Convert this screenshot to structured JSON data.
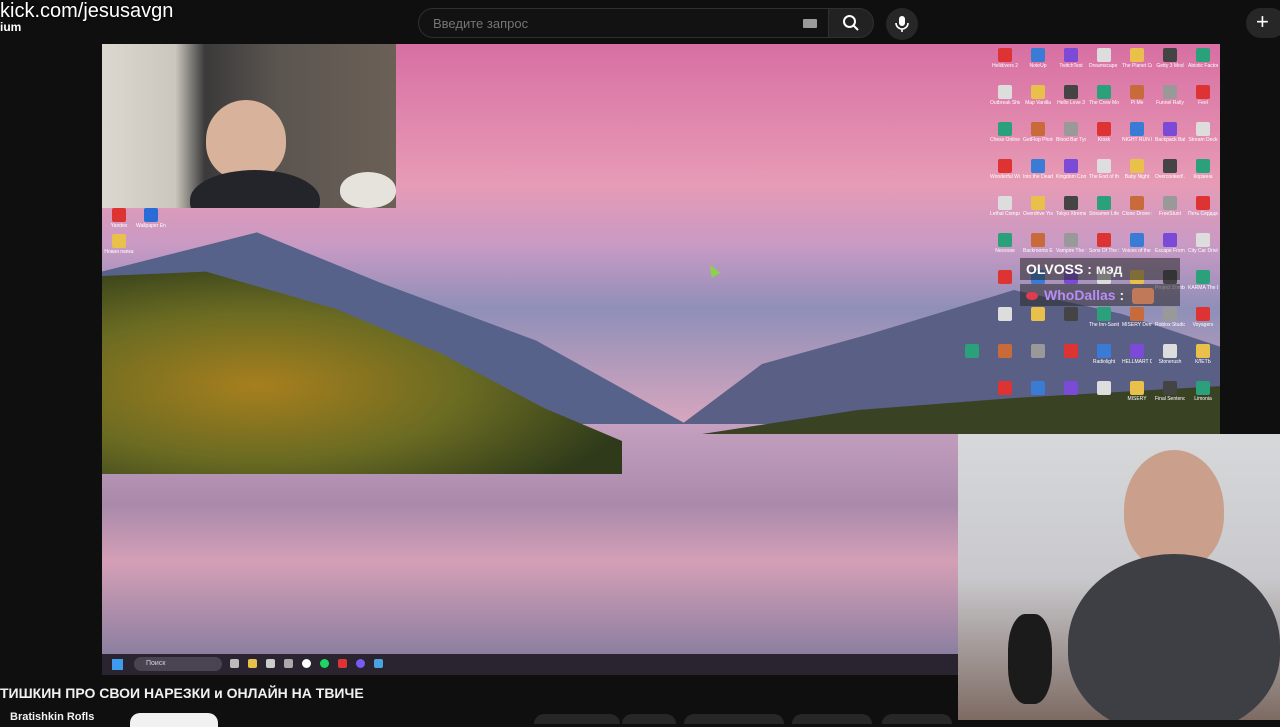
{
  "overlay": {
    "url": "kick.com/jesusavgn",
    "brand_fragment": "ium"
  },
  "header": {
    "search_placeholder": "Введите запрос",
    "create_label": "+"
  },
  "desktop": {
    "left_icons": [
      "Yandex",
      "Wallpaper Engine",
      "Новая папка"
    ],
    "icons": [
      [
        "Helldivers 2",
        "NoteUp",
        "TwitchTest",
        "Dreamscape Demo",
        "The Planet Crafter",
        "Getty 3 Mod",
        "Abiotic Factor"
      ],
      [
        "Outbreak Shield",
        "Map Vanilla",
        "Hello Love 3",
        "The Crew Motorfest",
        "Pi Me",
        "Funnel Rally",
        "Feel"
      ],
      [
        "Chess Online",
        "GetFlop Photograph",
        "Blood Bar Tycoon",
        "Kiosk",
        "NIGHT RUN PROTOCOL",
        "Backpack Battles",
        "Stream Deck"
      ],
      [
        "Wonderful Wonder",
        "Into the Dead Our Darkest Days",
        "Kingdom Come Deliverance",
        "The End of the Dark",
        "Baby Night",
        "Overcooked! All You Can Eat",
        "Корзина"
      ],
      [
        "Lethal Company",
        "Overdrive Your Road",
        "Tokyo Xtreme Racer",
        "Streamer Life Simulator 2",
        "Clone Drone in the Danger Zone",
        "FreeStunt",
        "Петь Сердце Под Одеяло"
      ],
      [
        "Necesse",
        "Backrooms Escape Together",
        "Vampire The Masquerade",
        "Sons Of The Forest",
        "Voices of the Void",
        "Escape From Tarkov",
        "City Car Driving"
      ],
      [
        "",
        "",
        "",
        "",
        "",
        "Project Zomboid",
        "KARMA The Dark World"
      ],
      [
        "",
        "",
        "",
        "The Inn-Sanity",
        "MISERY Demo",
        "Roblox Studio",
        "Voyagers"
      ],
      [
        "",
        "",
        "",
        "",
        "Radiolight",
        "HELLMART Demo",
        "Stonerush",
        "КЛЕТЬ"
      ],
      [
        "",
        "",
        "",
        "",
        "MISERY",
        "Final Sentence",
        "Limonia"
      ]
    ]
  },
  "taskbar": {
    "search_label": "Поиск"
  },
  "chat": [
    {
      "user": "OLVOSS",
      "separator": " : ",
      "message": "мэд",
      "color": "#ffffff"
    },
    {
      "user": "WhoDallas",
      "separator": " : ",
      "message": "",
      "color": "#b88cf5"
    }
  ],
  "video": {
    "title": "ТИШКИН ПРО СВОИ НАРЕЗКИ и ОНЛАЙН НА ТВИЧЕ",
    "channel": "Bratishkin Rofls"
  },
  "colors": {
    "background": "#0f0f0f",
    "accent_purple": "#b88cf5",
    "chat_badge": "#e23a4e"
  }
}
